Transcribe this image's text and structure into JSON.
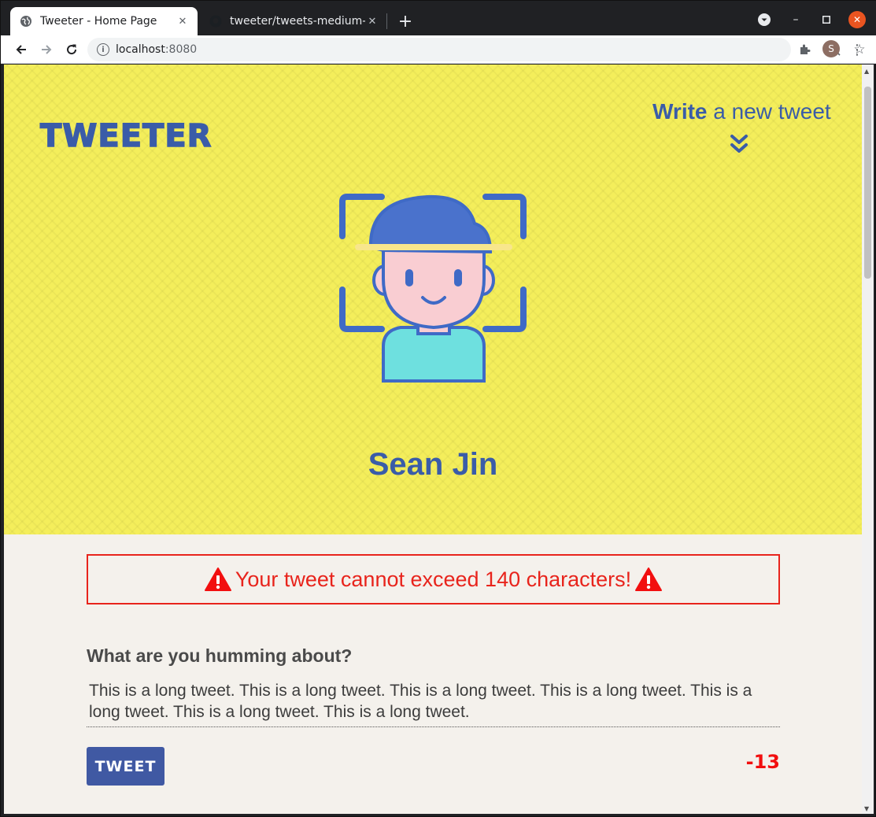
{
  "browser": {
    "tabs": [
      {
        "title": "Tweeter - Home Page",
        "icon": "globe-icon",
        "active": true
      },
      {
        "title": "tweeter/tweets-medium-",
        "icon": "github-icon",
        "active": false
      }
    ],
    "new_tab_label": "+",
    "url_host": "localhost",
    "url_port": ":8080",
    "profile_initial": "S",
    "colors": {
      "close_button": "#e95420",
      "profile": "#8d6e63"
    }
  },
  "header": {
    "logo": "TWEETER",
    "write_bold": "Write",
    "write_rest": " a new tweet",
    "chevron_icon": "double-chevron-down-icon"
  },
  "profile": {
    "name": "Sean Jin",
    "avatar_icon": "face-scan-avatar-icon"
  },
  "error": {
    "message": "Your tweet cannot exceed 140 characters!",
    "icon": "warning-icon",
    "color": "#e8241c"
  },
  "compose": {
    "label": "What are you humming about?",
    "text": "This is a long tweet. This is a long tweet. This is a long tweet. This is a long tweet. This is a long tweet. This is a long tweet. This is a long tweet.",
    "button_label": "TWEET",
    "counter": "-13",
    "counter_color": "#f20f0f"
  },
  "theme": {
    "accent": "#3a5ca8",
    "hero_bg": "#f4ee5b",
    "page_bg": "#f4f1ec"
  }
}
